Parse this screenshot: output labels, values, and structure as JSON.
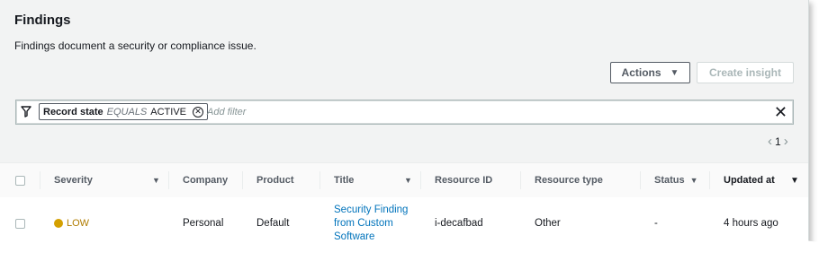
{
  "page": {
    "title": "Findings",
    "description": "Findings document a security or compliance issue."
  },
  "toolbar": {
    "actions_label": "Actions",
    "create_insight_label": "Create insight"
  },
  "filter": {
    "token_key": "Record state",
    "token_operator": "EQUALS",
    "token_value": "ACTIVE",
    "add_filter_placeholder": "Add filter"
  },
  "pagination": {
    "current_page": "1"
  },
  "table": {
    "columns": {
      "severity": "Severity",
      "company": "Company",
      "product": "Product",
      "title": "Title",
      "resource_id": "Resource ID",
      "resource_type": "Resource type",
      "status": "Status",
      "updated_at": "Updated at"
    },
    "rows": [
      {
        "severity": "LOW",
        "company": "Personal",
        "product": "Default",
        "title_line1": "Security Finding",
        "title_line2": "from Custom",
        "title_line3": "Software",
        "resource_id": "i-decafbad",
        "resource_type": "Other",
        "status": "-",
        "updated_at": "4 hours ago"
      }
    ]
  },
  "colors": {
    "severity_low": "#d4a000",
    "link": "#0073bb",
    "panel_bg": "#f2f3f3"
  }
}
